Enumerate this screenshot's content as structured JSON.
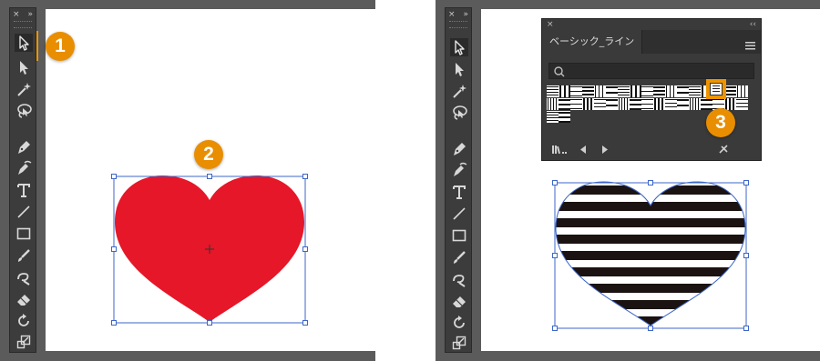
{
  "steps": [
    "1",
    "2",
    "3"
  ],
  "toolbar": {
    "close_glyph": "×",
    "collapse_glyph": "»",
    "tools": [
      "selection-tool",
      "direct-selection-tool",
      "magic-wand-tool",
      "lasso-tool",
      "pen-tool",
      "curvature-tool",
      "type-tool",
      "line-segment-tool",
      "rectangle-tool",
      "paintbrush-tool",
      "shaper-tool",
      "eraser-tool",
      "rotate-tool",
      "scale-tool"
    ]
  },
  "panel": {
    "close_glyph": "×",
    "collapse_glyph": "‹‹",
    "tab_label": "ベーシック_ライン",
    "search_placeholder": ""
  },
  "colors": {
    "highlight": "#ee9400",
    "badge": "#e88e00",
    "heart_fill": "#e51728",
    "stripe_dark": "#1b1212",
    "selection_blue": "#3d66c8",
    "ui_dark": "#3c3c3c",
    "ui_frame": "#5b5b5b"
  }
}
